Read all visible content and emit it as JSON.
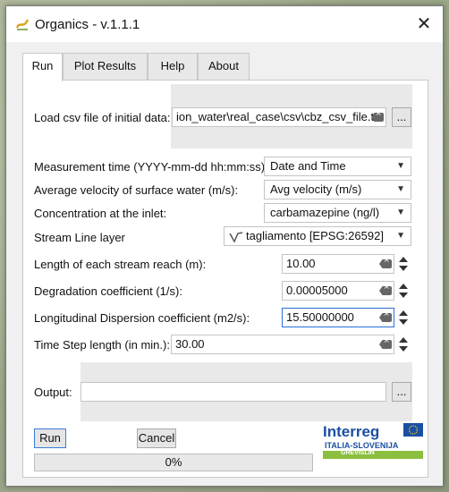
{
  "window": {
    "title": "Organics - v.1.1.1"
  },
  "tabs": [
    {
      "label": "Run"
    },
    {
      "label": "Plot Results"
    },
    {
      "label": "Help"
    },
    {
      "label": "About"
    }
  ],
  "form": {
    "load_csv_label": "Load csv file of initial data:",
    "load_csv_value": "ion_water\\real_case\\csv\\cbz_csv_file.txt",
    "browse_label": "...",
    "measurement_time_label": "Measurement time (YYYY-mm-dd hh:mm:ss):",
    "measurement_time_value": "Date and Time",
    "avg_velocity_label": "Average velocity of surface water (m/s):",
    "avg_velocity_value": "Avg velocity (m/s)",
    "concentration_label": "Concentration at the inlet:",
    "concentration_value": "carbamazepine (ng/l)",
    "stream_line_label": "Stream Line layer",
    "stream_line_value": "tagliamento [EPSG:26592]",
    "reach_length_label": "Length of each stream reach (m):",
    "reach_length_value": "10.00",
    "degradation_label": "Degradation coefficient (1/s):",
    "degradation_value": "0.00005000",
    "dispersion_label": "Longitudinal Dispersion coefficient  (m2/s):",
    "dispersion_value": "15.50000000",
    "time_step_label": "Time Step length (in min.):",
    "time_step_value": "30.00",
    "output_label": "Output:",
    "output_value": "",
    "output_browse_label": "..."
  },
  "buttons": {
    "run": "Run",
    "cancel": "Cancel"
  },
  "progress": {
    "text": "0%",
    "value": 0
  },
  "logo": {
    "brand": "Interreg",
    "program": "ITALIA-SLOVENIJA",
    "project": "GREVISLIN",
    "brand_color": "#1a4fa3",
    "accent_color": "#8bbf3f"
  },
  "icons": [
    "app-icon",
    "close-icon",
    "clear-icon",
    "spin-up-icon",
    "spin-down-icon",
    "line-layer-icon",
    "chevron-down-icon",
    "eu-flag-icon"
  ]
}
